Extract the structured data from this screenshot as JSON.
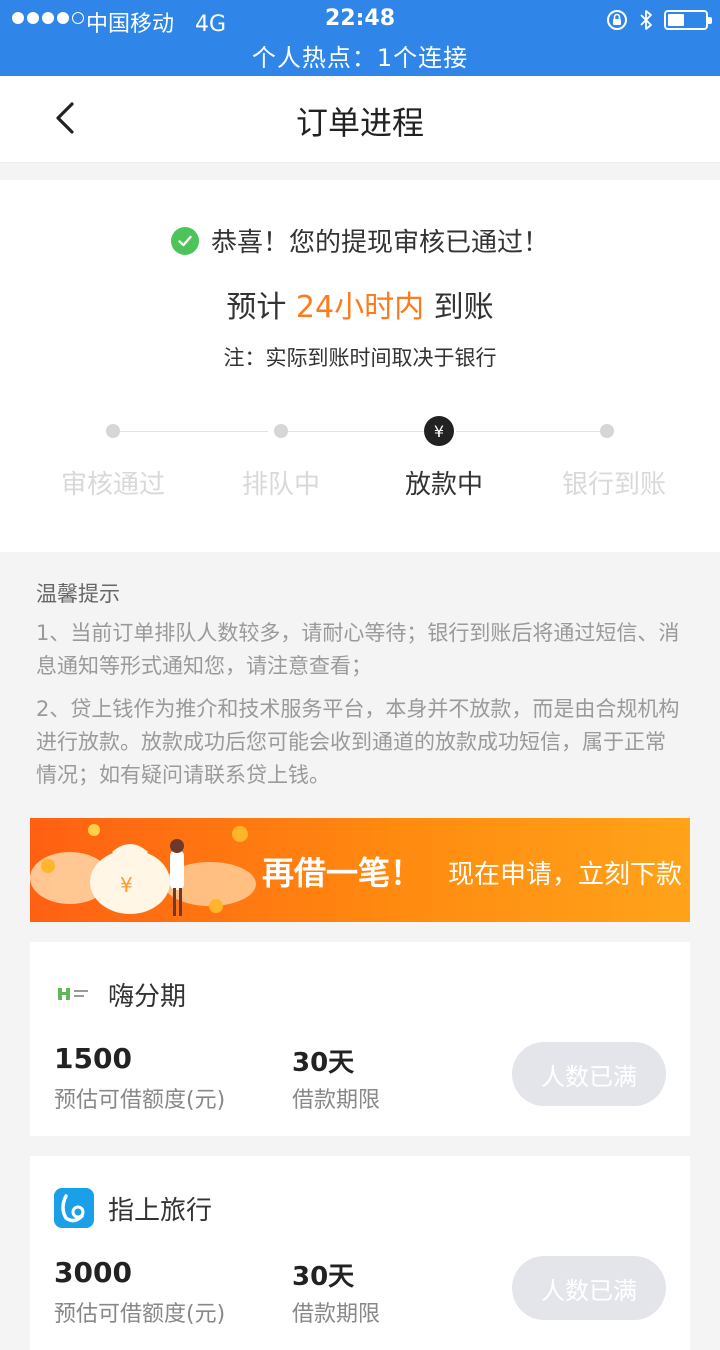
{
  "status_bar": {
    "carrier": "中国移动",
    "network": "4G",
    "time": "22:48",
    "hotspot": "个人热点：1个连接",
    "battery_level": 0.45,
    "icons": [
      "signal-dots-icon",
      "orientation-lock-icon",
      "bluetooth-icon",
      "battery-icon"
    ]
  },
  "nav": {
    "title": "订单进程",
    "back_icon": "chevron-left-icon"
  },
  "result": {
    "success_text": "恭喜！您的提现审核已通过！",
    "eta_prefix": "预计 ",
    "eta_highlight": "24小时内",
    "eta_suffix": " 到账",
    "note": "注：实际到账时间取决于银行"
  },
  "steps": [
    {
      "label": "审核通过",
      "state": "done"
    },
    {
      "label": "排队中",
      "state": "done"
    },
    {
      "label": "放款中",
      "state": "current",
      "icon": "yen-icon"
    },
    {
      "label": "银行到账",
      "state": "pending"
    }
  ],
  "tips": {
    "title": "温馨提示",
    "items": [
      "1、当前订单排队人数较多，请耐心等待；银行到账后将通过短信、消息通知等形式通知您，请注意查看；",
      "2、贷上钱作为推介和技术服务平台，本身并不放款，而是由合规机构进行放款。放款成功后您可能会收到通道的放款成功短信，属于正常情况；如有疑问请联系贷上钱。"
    ]
  },
  "banner": {
    "title": "再借一笔！",
    "subtitle": "现在申请，立刻下款"
  },
  "products": [
    {
      "name": "嗨分期",
      "amount": "1500",
      "amount_label": "预估可借额度(元)",
      "term": "30天",
      "term_label": "借款期限",
      "button": "人数已满",
      "logo": "hi-fenqi-logo-icon"
    },
    {
      "name": "指上旅行",
      "amount": "3000",
      "amount_label": "预估可借额度(元)",
      "term": "30天",
      "term_label": "借款期限",
      "button": "人数已满",
      "logo": "zhishang-travel-logo-icon"
    }
  ],
  "colors": {
    "status_bar": "#2f86e8",
    "accent_orange": "#ff7a1a",
    "success_green": "#4cc45a",
    "disabled_button": "#e3e5ea"
  }
}
